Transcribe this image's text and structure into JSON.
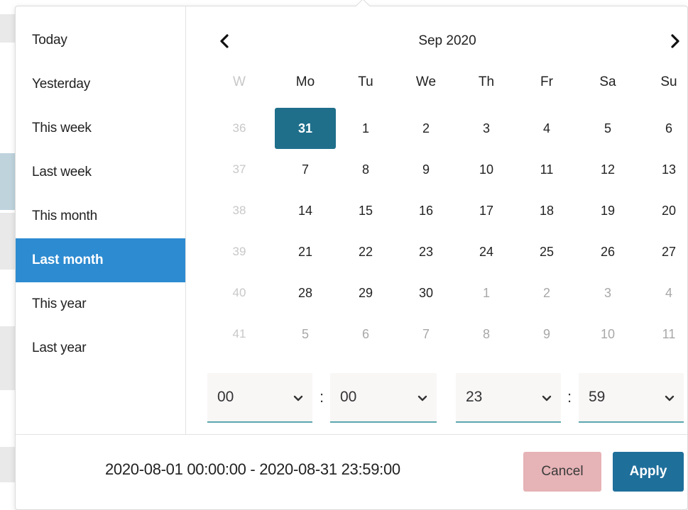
{
  "presets": [
    "Today",
    "Yesterday",
    "This week",
    "Last week",
    "This month",
    "Last month",
    "This year",
    "Last year"
  ],
  "active_preset": "Last month",
  "calendar": {
    "month_label": "Sep 2020",
    "week_header": "W",
    "weekdays": [
      "Mo",
      "Tu",
      "We",
      "Th",
      "Fr",
      "Sa",
      "Su"
    ],
    "weeks": [
      {
        "num": "36",
        "days": [
          {
            "d": "31",
            "state": "selected"
          },
          {
            "d": "1"
          },
          {
            "d": "2"
          },
          {
            "d": "3"
          },
          {
            "d": "4"
          },
          {
            "d": "5"
          },
          {
            "d": "6"
          }
        ]
      },
      {
        "num": "37",
        "days": [
          {
            "d": "7"
          },
          {
            "d": "8"
          },
          {
            "d": "9"
          },
          {
            "d": "10"
          },
          {
            "d": "11"
          },
          {
            "d": "12"
          },
          {
            "d": "13"
          }
        ]
      },
      {
        "num": "38",
        "days": [
          {
            "d": "14"
          },
          {
            "d": "15"
          },
          {
            "d": "16"
          },
          {
            "d": "17"
          },
          {
            "d": "18"
          },
          {
            "d": "19"
          },
          {
            "d": "20"
          }
        ]
      },
      {
        "num": "39",
        "days": [
          {
            "d": "21"
          },
          {
            "d": "22"
          },
          {
            "d": "23"
          },
          {
            "d": "24"
          },
          {
            "d": "25"
          },
          {
            "d": "26"
          },
          {
            "d": "27"
          }
        ]
      },
      {
        "num": "40",
        "days": [
          {
            "d": "28"
          },
          {
            "d": "29"
          },
          {
            "d": "30"
          },
          {
            "d": "1",
            "state": "other"
          },
          {
            "d": "2",
            "state": "other"
          },
          {
            "d": "3",
            "state": "other"
          },
          {
            "d": "4",
            "state": "other"
          }
        ]
      },
      {
        "num": "41",
        "days": [
          {
            "d": "5",
            "state": "other"
          },
          {
            "d": "6",
            "state": "other"
          },
          {
            "d": "7",
            "state": "other"
          },
          {
            "d": "8",
            "state": "other"
          },
          {
            "d": "9",
            "state": "other"
          },
          {
            "d": "10",
            "state": "other"
          },
          {
            "d": "11",
            "state": "other"
          }
        ]
      }
    ]
  },
  "time": {
    "start_hour": "00",
    "start_minute": "00",
    "end_hour": "23",
    "end_minute": "59",
    "separator": ":"
  },
  "range_text": "2020-08-01 00:00:00 - 2020-08-31 23:59:00",
  "buttons": {
    "cancel": "Cancel",
    "apply": "Apply"
  },
  "colors": {
    "active_preset": "#2d8bd1",
    "selected_day": "#1f6f8b",
    "apply": "#1f6f9b",
    "cancel": "#e6b3b6",
    "select_underline": "#5aa7ae"
  }
}
